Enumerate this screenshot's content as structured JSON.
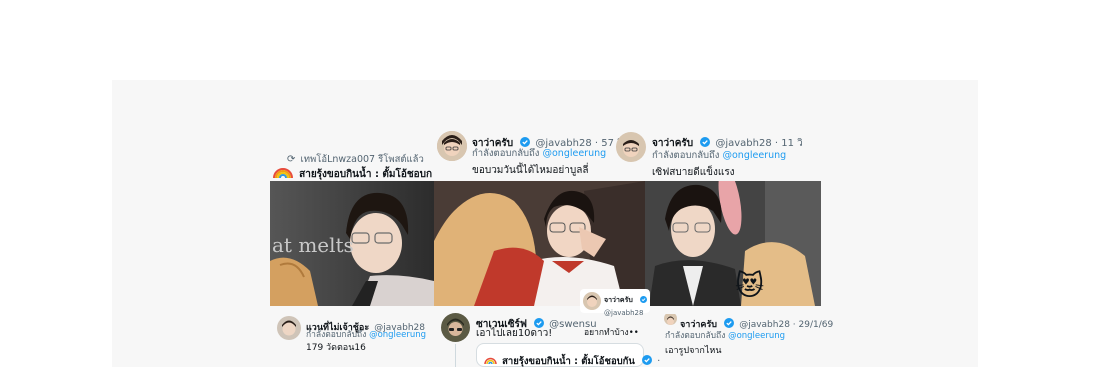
{
  "retweet": {
    "by": "เทพโอ้Lnwza007 รีโพสต์แล้ว",
    "quote_author": "สายรุ้งขอบกินน้ำ : ตั้มโอ้ชอบก"
  },
  "tweet_a": {
    "name": "จาว่าครับ",
    "handle": "@javabh28 · 57 วิ",
    "reply_prefix": "กำลังตอบกลับถึง",
    "reply_mention": "@ongleerung",
    "text": "ขอบวมวันนี้ได้ไหมอย่าบูลลี่"
  },
  "tweet_b": {
    "name": "จาว่าครับ",
    "handle": "@javabh28 · 11 วิ",
    "reply_prefix": "กำลังตอบกลับถึง",
    "reply_mention": "@ongleerung",
    "text": "เซิฟสบายดีแข็งแรง"
  },
  "photo1": {
    "caption": "at melts"
  },
  "card_1": {
    "name": "แวนที่ไม่เจ้าชู้อะ",
    "handle": "@javabh28",
    "reply_prefix": "กำลังตอบกลับถึง",
    "reply_mention": "@ongleerung",
    "text": "179 วัดตอน16"
  },
  "card_2": {
    "name": "ซาเวนเซิร์ฟ",
    "handle": "@swensu",
    "text": "เอาไปเลย10ดาว!"
  },
  "card_2_quote": {
    "name": "สายรุ้งขอบกินน้ำ : ตั้มโอ้ชอบกัน",
    "dot": "·"
  },
  "card_small": {
    "name": "จาว่าครับ",
    "handle": "@javabh28",
    "text": "อยากทำบ้าง••"
  },
  "card_3": {
    "name": "จาว่าครับ",
    "handle": "@javabh28 · 29/1/69",
    "reply_prefix": "กำลังตอบกลับถึง",
    "reply_mention": "@ongleerung",
    "text": "เอารูปจากไหน"
  },
  "colors": {
    "verified": "#1d9bf0",
    "link": "#1d9bf0",
    "muted": "#536471",
    "text": "#0f1419"
  }
}
